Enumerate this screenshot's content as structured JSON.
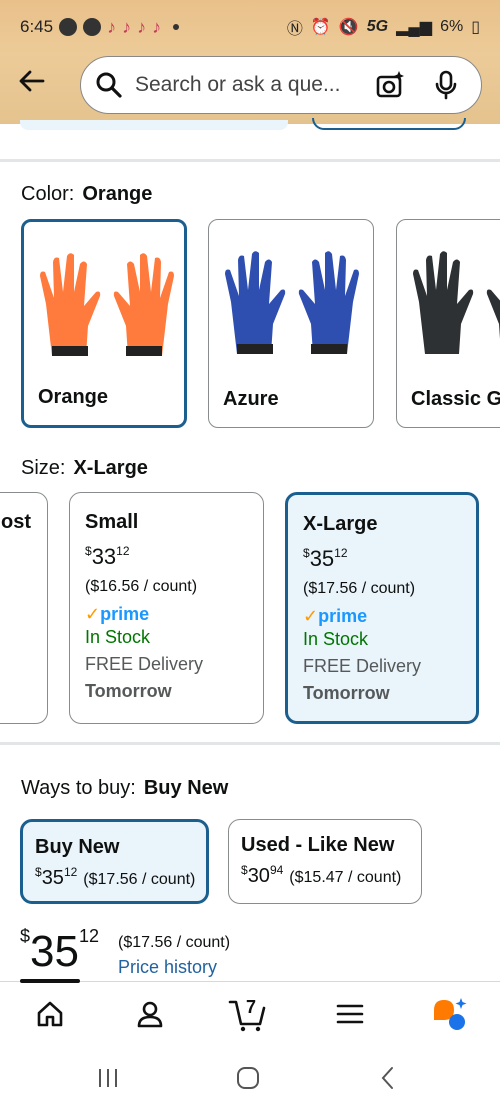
{
  "status_bar": {
    "time": "6:45",
    "network": "5G",
    "battery": "6%"
  },
  "search": {
    "placeholder": "Search or ask a que..."
  },
  "color_section": {
    "label": "Color:",
    "selected_value": "Orange",
    "options": [
      {
        "label": "Orange",
        "color": "#ff7a3d",
        "selected": true
      },
      {
        "label": "Azure",
        "color": "#2f4fb0",
        "selected": false
      },
      {
        "label": "Classic G",
        "color": "#2d3134",
        "selected": false
      }
    ]
  },
  "size_section": {
    "label": "Size:",
    "selected_value": "X-Large",
    "partial_card_text": "ost",
    "options": [
      {
        "name": "Small",
        "price_whole": "33",
        "price_cents": "12",
        "currency": "$",
        "unit_price": "($16.56 / count)",
        "prime_label": "prime",
        "stock": "In Stock",
        "delivery": "FREE Delivery",
        "delivery_day": "Tomorrow",
        "selected": false
      },
      {
        "name": "X-Large",
        "price_whole": "35",
        "price_cents": "12",
        "currency": "$",
        "unit_price": "($17.56 / count)",
        "prime_label": "prime",
        "stock": "In Stock",
        "delivery": "FREE Delivery",
        "delivery_day": "Tomorrow",
        "selected": true
      }
    ]
  },
  "ways_to_buy": {
    "label": "Ways to buy:",
    "selected_value": "Buy New",
    "options": [
      {
        "title": "Buy New",
        "currency": "$",
        "price_whole": "35",
        "price_cents": "12",
        "unit_price": "($17.56 / count)",
        "selected": true
      },
      {
        "title": "Used - Like New",
        "currency": "$",
        "price_whole": "30",
        "price_cents": "94",
        "unit_price": "($15.47 / count)",
        "selected": false
      }
    ]
  },
  "main_price": {
    "currency": "$",
    "whole": "35",
    "cents": "12",
    "unit_price": "($17.56 / count)",
    "history_link": "Price history"
  },
  "bottom_nav": {
    "cart_count": "7",
    "items": [
      "home-icon",
      "account-icon",
      "cart-icon",
      "menu-icon",
      "rufus-icon"
    ]
  },
  "colors": {
    "accent": "#1b5f8f",
    "selected_bg": "#eaf4fb",
    "in_stock": "#007600",
    "link": "#2162a1",
    "prime": "#1a98ff",
    "header_bg": "#eccb98"
  }
}
